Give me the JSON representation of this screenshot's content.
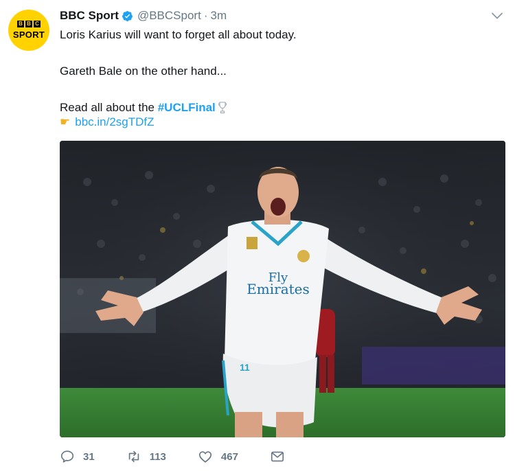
{
  "account": {
    "avatar_top": "BBC",
    "avatar_bottom": "SPORT",
    "display_name": "BBC Sport",
    "handle": "@BBCSport",
    "separator": "·",
    "time": "3m"
  },
  "tweet": {
    "line1": "Loris Karius will want to forget all about today.",
    "line2": "Gareth Bale on the other hand...",
    "line3_prefix": "Read all about the ",
    "hashtag": "#UCLFinal",
    "link": "bbc.in/2sgTDfZ"
  },
  "photo": {
    "shirt_sponsor_top": "Fly",
    "shirt_sponsor_bottom": "Emirates",
    "shirt_number": "11"
  },
  "actions": {
    "replies": "31",
    "retweets": "113",
    "likes": "467"
  },
  "icons": [
    "verified-icon",
    "chevron-down-icon",
    "trophy-icon",
    "pointing-hand-icon",
    "reply-icon",
    "retweet-icon",
    "like-icon",
    "direct-message-icon"
  ],
  "colors": {
    "brand_yellow": "#ffd200",
    "twitter_blue": "#1da1f2",
    "muted_gray": "#657786"
  }
}
